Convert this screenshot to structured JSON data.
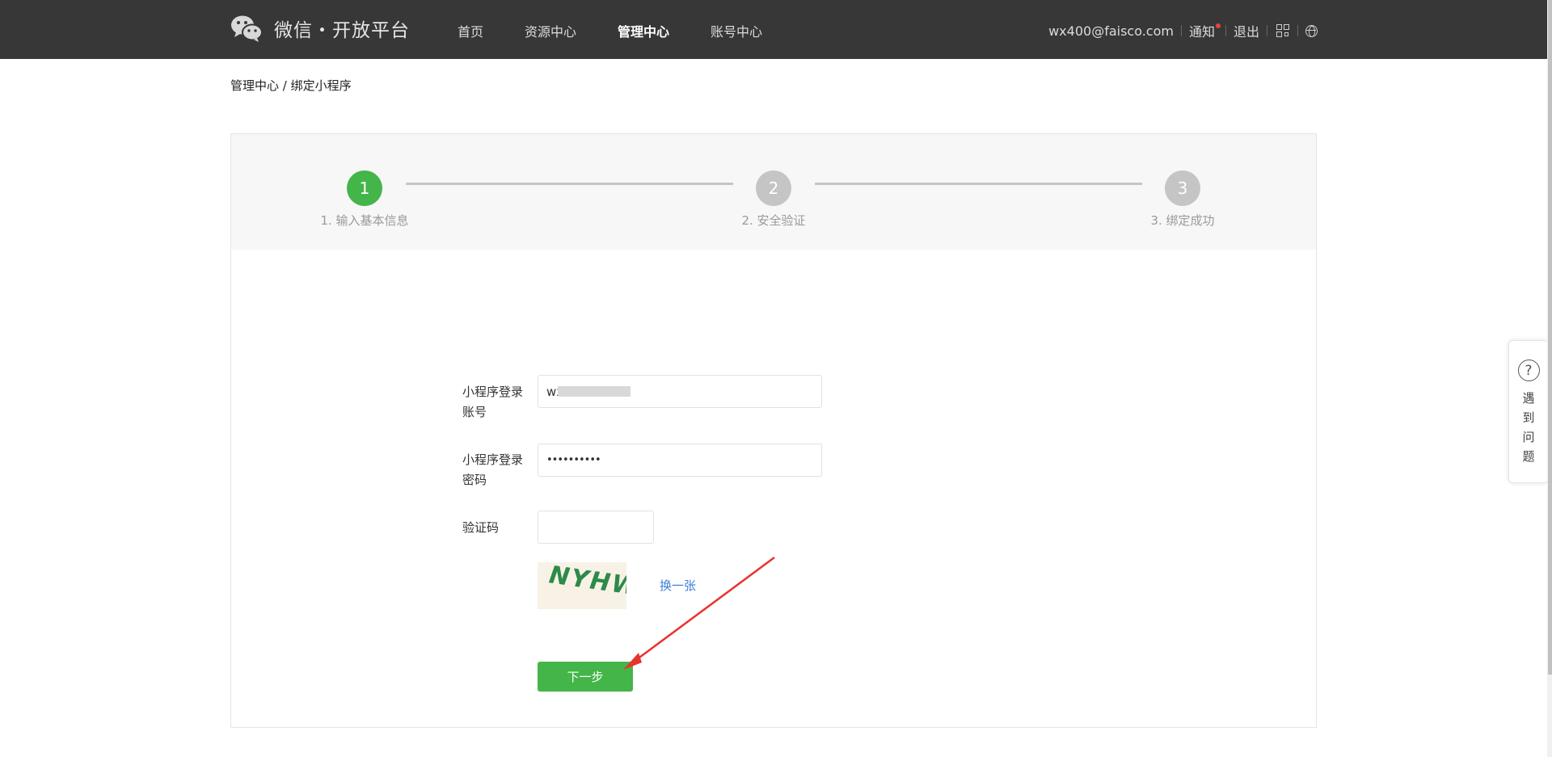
{
  "header": {
    "brand": "微信・开放平台",
    "nav": [
      "首页",
      "资源中心",
      "管理中心",
      "账号中心"
    ],
    "active_nav_index": 2,
    "account_email": "wx400@faisco.com",
    "notice_label": "通知",
    "logout_label": "退出"
  },
  "breadcrumb": "管理中心 / 绑定小程序",
  "steps": [
    {
      "number": "1",
      "label": "1. 输入基本信息"
    },
    {
      "number": "2",
      "label": "2. 安全验证"
    },
    {
      "number": "3",
      "label": "3. 绑定成功"
    }
  ],
  "current_step": 1,
  "form": {
    "account_label": "小程序登录账号",
    "account_value": "wx",
    "password_label": "小程序登录密码",
    "password_value": "••••••••••",
    "captcha_label": "验证码",
    "captcha_value": "",
    "captcha_image_text": "NYHW",
    "refresh_label": "换一张",
    "next_label": "下一步"
  },
  "help": {
    "label": "遇到问题"
  },
  "colors": {
    "header_bg": "#373737",
    "primary_green": "#44b549",
    "inactive_step": "#c5c5c5",
    "link_blue": "#3b7fd6",
    "annotation_arrow": "#e8322e"
  }
}
